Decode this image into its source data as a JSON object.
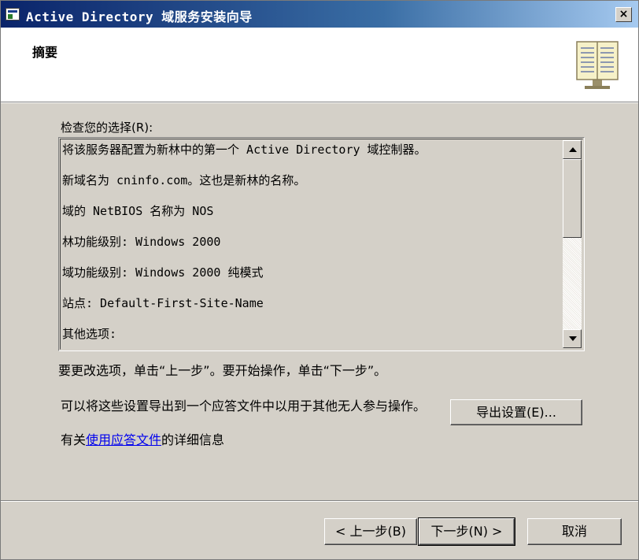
{
  "window": {
    "title": "Active Directory 域服务安装向导",
    "close_label": "×"
  },
  "header": {
    "title": "摘要",
    "icon": "book-icon"
  },
  "review": {
    "label": "检查您的选择(R):",
    "lines": [
      "将该服务器配置为新林中的第一个 Active Directory 域控制器。",
      "新域名为 cninfo.com。这也是新林的名称。",
      "域的 NetBIOS 名称为 NOS",
      "林功能级别: Windows 2000",
      "域功能级别: Windows 2000 纯模式",
      "站点: Default-First-Site-Name",
      "其他选项:"
    ]
  },
  "instruction": "要更改选项，单击“上一步”。要开始操作，单击“下一步”。",
  "export": {
    "description": "可以将这些设置导出到一个应答文件中以用于其他无人参与操作。",
    "button_label": "导出设置(E)..."
  },
  "more_info": {
    "prefix": "有关",
    "link_text": "使用应答文件",
    "suffix": "的详细信息"
  },
  "buttons": {
    "back": "< 上一步(B)",
    "next": "下一步(N) >",
    "cancel": "取消"
  },
  "colors": {
    "dialog_bg": "#d4d0c8",
    "title_bar": "#0a246a",
    "link": "#0000ee"
  }
}
